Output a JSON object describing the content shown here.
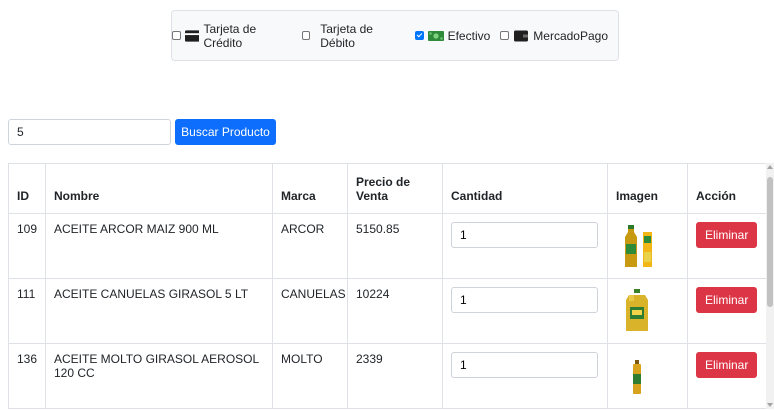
{
  "payment": {
    "options": [
      {
        "label": "Tarjeta de Crédito",
        "checked": false,
        "icon": "credit-card-icon"
      },
      {
        "label": "Tarjeta de Débito",
        "checked": false,
        "icon": ""
      },
      {
        "label": "Efectivo",
        "checked": true,
        "icon": "cash-icon"
      },
      {
        "label": "MercadoPago",
        "checked": false,
        "icon": "wallet-icon"
      }
    ]
  },
  "search": {
    "value": "5",
    "button_label": "Buscar Producto"
  },
  "table": {
    "headers": {
      "id": "ID",
      "nombre": "Nombre",
      "marca": "Marca",
      "precio": "Precio de Venta",
      "cantidad": "Cantidad",
      "imagen": "Imagen",
      "accion": "Acción"
    },
    "rows": [
      {
        "id": "109",
        "nombre": "ACEITE ARCOR MAIZ 900 ML",
        "marca": "ARCOR",
        "precio": "5150.85",
        "cantidad": "1",
        "action": "Eliminar",
        "image": "oil-bottle-with-box"
      },
      {
        "id": "111",
        "nombre": "ACEITE CANUELAS GIRASOL 5 LT",
        "marca": "CANUELAS",
        "precio": "10224",
        "cantidad": "1",
        "action": "Eliminar",
        "image": "oil-jug"
      },
      {
        "id": "136",
        "nombre": "ACEITE MOLTO GIRASOL AEROSOL 120 CC",
        "marca": "MOLTO",
        "precio": "2339",
        "cantidad": "1",
        "action": "Eliminar",
        "image": "oil-aerosol"
      }
    ]
  },
  "colors": {
    "primary": "#0d6efd",
    "danger": "#dc3545",
    "panel": "#f8f9fa",
    "border": "#dee2e6",
    "cash_green": "#3a9a3a"
  }
}
